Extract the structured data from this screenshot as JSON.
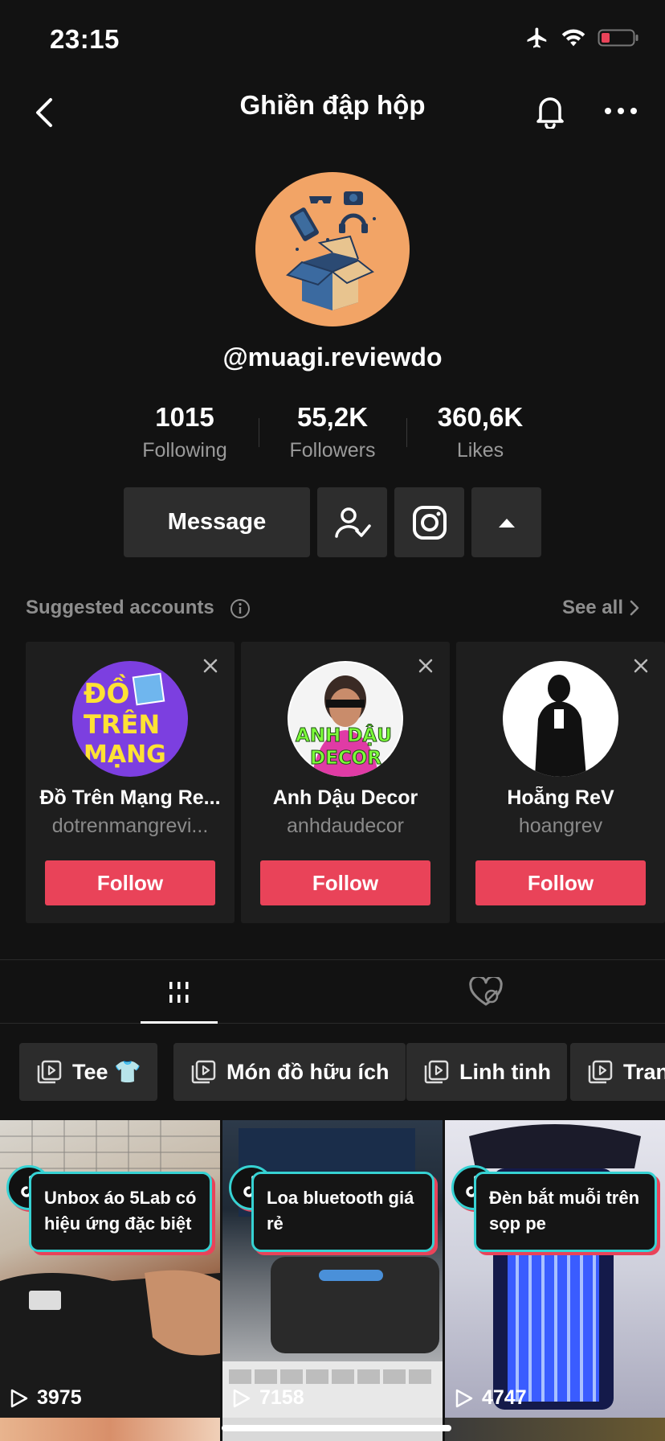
{
  "status_bar": {
    "time": "23:15"
  },
  "header": {
    "title": "Ghiền đập hộp"
  },
  "profile": {
    "username": "@muagi.reviewdo",
    "stats": [
      {
        "value": "1015",
        "label": "Following"
      },
      {
        "value": "55,2K",
        "label": "Followers"
      },
      {
        "value": "360,6K",
        "label": "Likes"
      }
    ],
    "message_label": "Message"
  },
  "suggested": {
    "title": "Suggested accounts",
    "see_all": "See all",
    "accounts": [
      {
        "name": "Đồ Trên Mạng Re...",
        "handle": "dotrenmangrevi...",
        "follow": "Follow",
        "avatar_text": "ĐỒ TRÊN MẠNG"
      },
      {
        "name": "Anh Dậu Decor",
        "handle": "anhdaudecor",
        "follow": "Follow",
        "avatar_text": "ANH DẬU DECOR"
      },
      {
        "name": "Hoẵng ReV",
        "handle": "hoangrev",
        "follow": "Follow"
      }
    ]
  },
  "playlists": [
    {
      "label": "Tee 👕"
    },
    {
      "label": "Món đồ hữu ích"
    },
    {
      "label": "Linh tinh"
    },
    {
      "label": "Tran"
    }
  ],
  "videos": [
    {
      "caption": "Unbox áo 5Lab có hiệu ứng đặc biệt",
      "views": "3975"
    },
    {
      "caption": "Loa bluetooth giá rẻ",
      "views": "7158"
    },
    {
      "caption": "Đèn bắt muỗi trên sọp pe",
      "views": "4747"
    }
  ],
  "colors": {
    "accent": "#e94359",
    "background": "#121212",
    "avatar_bg": "#f2a466"
  }
}
